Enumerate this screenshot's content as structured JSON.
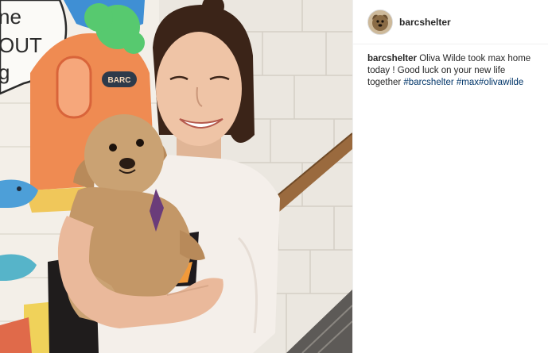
{
  "post": {
    "username": "barcshelter",
    "avatar_icon": "dog-avatar-icon",
    "caption": {
      "username": "barcshelter",
      "text": " Oliva Wilde took max home today ! Good luck on your new life together ",
      "hashtags": [
        "#barcshelter",
        "#max",
        "#olivawilde"
      ]
    }
  },
  "photo": {
    "mural_badge_text": "BARC",
    "mural_text_lines": [
      "ne",
      "OUT",
      "g"
    ]
  },
  "colors": {
    "link": "#003569",
    "text": "#262626",
    "border": "#efefef"
  }
}
